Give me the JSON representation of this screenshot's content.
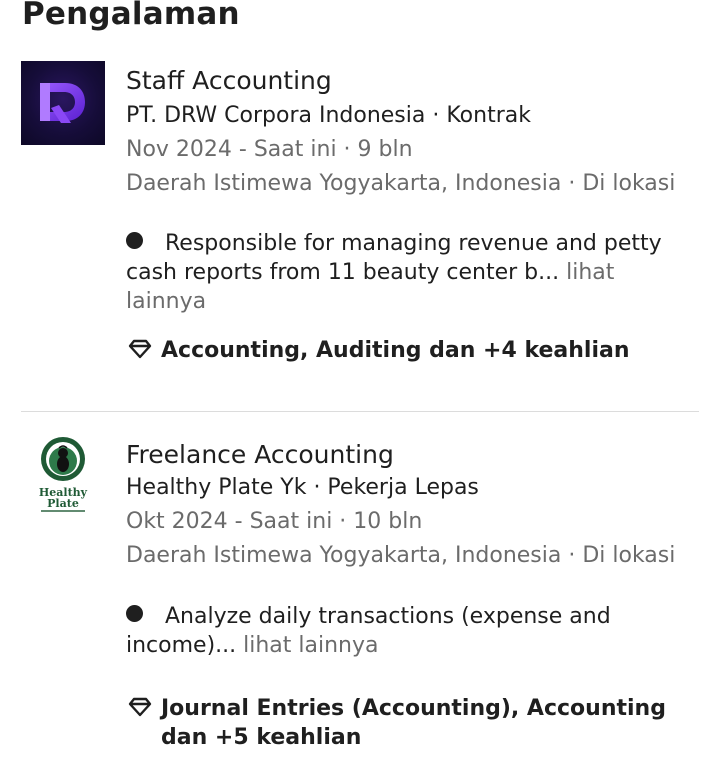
{
  "section": {
    "title": "Pengalaman"
  },
  "experiences": [
    {
      "logo_icon": "drw-corpora-logo",
      "title": "Staff Accounting",
      "company_line": "PT. DRW Corpora Indonesia · Kontrak",
      "date_line": "Nov 2024 - Saat ini · 9 bln",
      "location_line": "Daerah Istimewa Yogyakarta, Indonesia · Di lokasi",
      "description": "Responsible for managing revenue and petty cash reports from 11 beauty center b...",
      "see_more": "lihat lainnya",
      "skills_icon": "diamond-icon",
      "skills": "Accounting, Auditing dan +4 keahlian"
    },
    {
      "logo_icon": "healthy-plate-logo",
      "logo_text_line1": "Healthy",
      "logo_text_line2": "Plate",
      "title": "Freelance Accounting",
      "company_line": "Healthy Plate Yk · Pekerja Lepas",
      "date_line": "Okt 2024 - Saat ini · 10 bln",
      "location_line": "Daerah Istimewa Yogyakarta, Indonesia · Di lokasi",
      "description": "Analyze daily transactions (expense and income)...",
      "see_more": "lihat lainnya",
      "skills_icon": "diamond-icon",
      "skills": "Journal Entries (Accounting), Accounting dan +5 keahlian"
    }
  ],
  "colors": {
    "text_primary": "#1f1f1f",
    "text_secondary": "#6b6b6b",
    "divider": "#dcdcdc",
    "drw_logo_bg": "#160d3a",
    "drw_logo_accent": "#7b3cf0",
    "healthy_plate_green": "#1f5a35"
  }
}
